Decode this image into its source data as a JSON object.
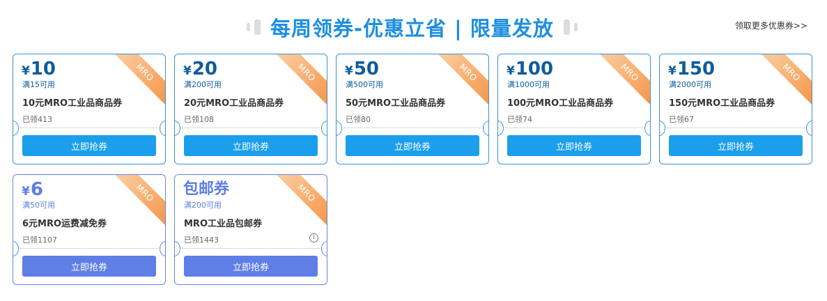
{
  "header": {
    "title": "每周领券-优惠立省 | 限量发放",
    "more_link": "领取更多优惠券>>",
    "title_color": "#1d8fe0"
  },
  "theme": {
    "blue_border": "#3e8fd8",
    "blue_button": "#1b9fec",
    "purple_border": "#6586e4",
    "purple_button": "#5f7fe7",
    "ribbon": "#f59548"
  },
  "coupons": [
    {
      "currency": "¥",
      "amount": "10",
      "condition": "满15可用",
      "name": "10元MRO工业品商品券",
      "claimed": "已领413",
      "ribbon": "MRO",
      "button": "立即抢券"
    },
    {
      "currency": "¥",
      "amount": "20",
      "condition": "满200可用",
      "name": "20元MRO工业品商品券",
      "claimed": "已领108",
      "ribbon": "MRO",
      "button": "立即抢券"
    },
    {
      "currency": "¥",
      "amount": "50",
      "condition": "满500可用",
      "name": "50元MRO工业品商品券",
      "claimed": "已领80",
      "ribbon": "MRO",
      "button": "立即抢券"
    },
    {
      "currency": "¥",
      "amount": "100",
      "condition": "满1000可用",
      "name": "100元MRO工业品商品券",
      "claimed": "已领74",
      "ribbon": "MRO",
      "button": "立即抢券"
    },
    {
      "currency": "¥",
      "amount": "150",
      "condition": "满2000可用",
      "name": "150元MRO工业品商品券",
      "claimed": "已领67",
      "ribbon": "MRO",
      "button": "立即抢券"
    },
    {
      "currency": "¥",
      "amount": "6",
      "condition": "满50可用",
      "name": "6元MRO运费减免券",
      "claimed": "已领1107",
      "ribbon": "MRO",
      "button": "立即抢券"
    },
    {
      "amount_text": "包邮券",
      "condition": "满200可用",
      "name": "MRO工业品包邮券",
      "claimed": "已领1443",
      "ribbon": "MRO",
      "button": "立即抢券",
      "info_icon": "info-icon"
    }
  ]
}
